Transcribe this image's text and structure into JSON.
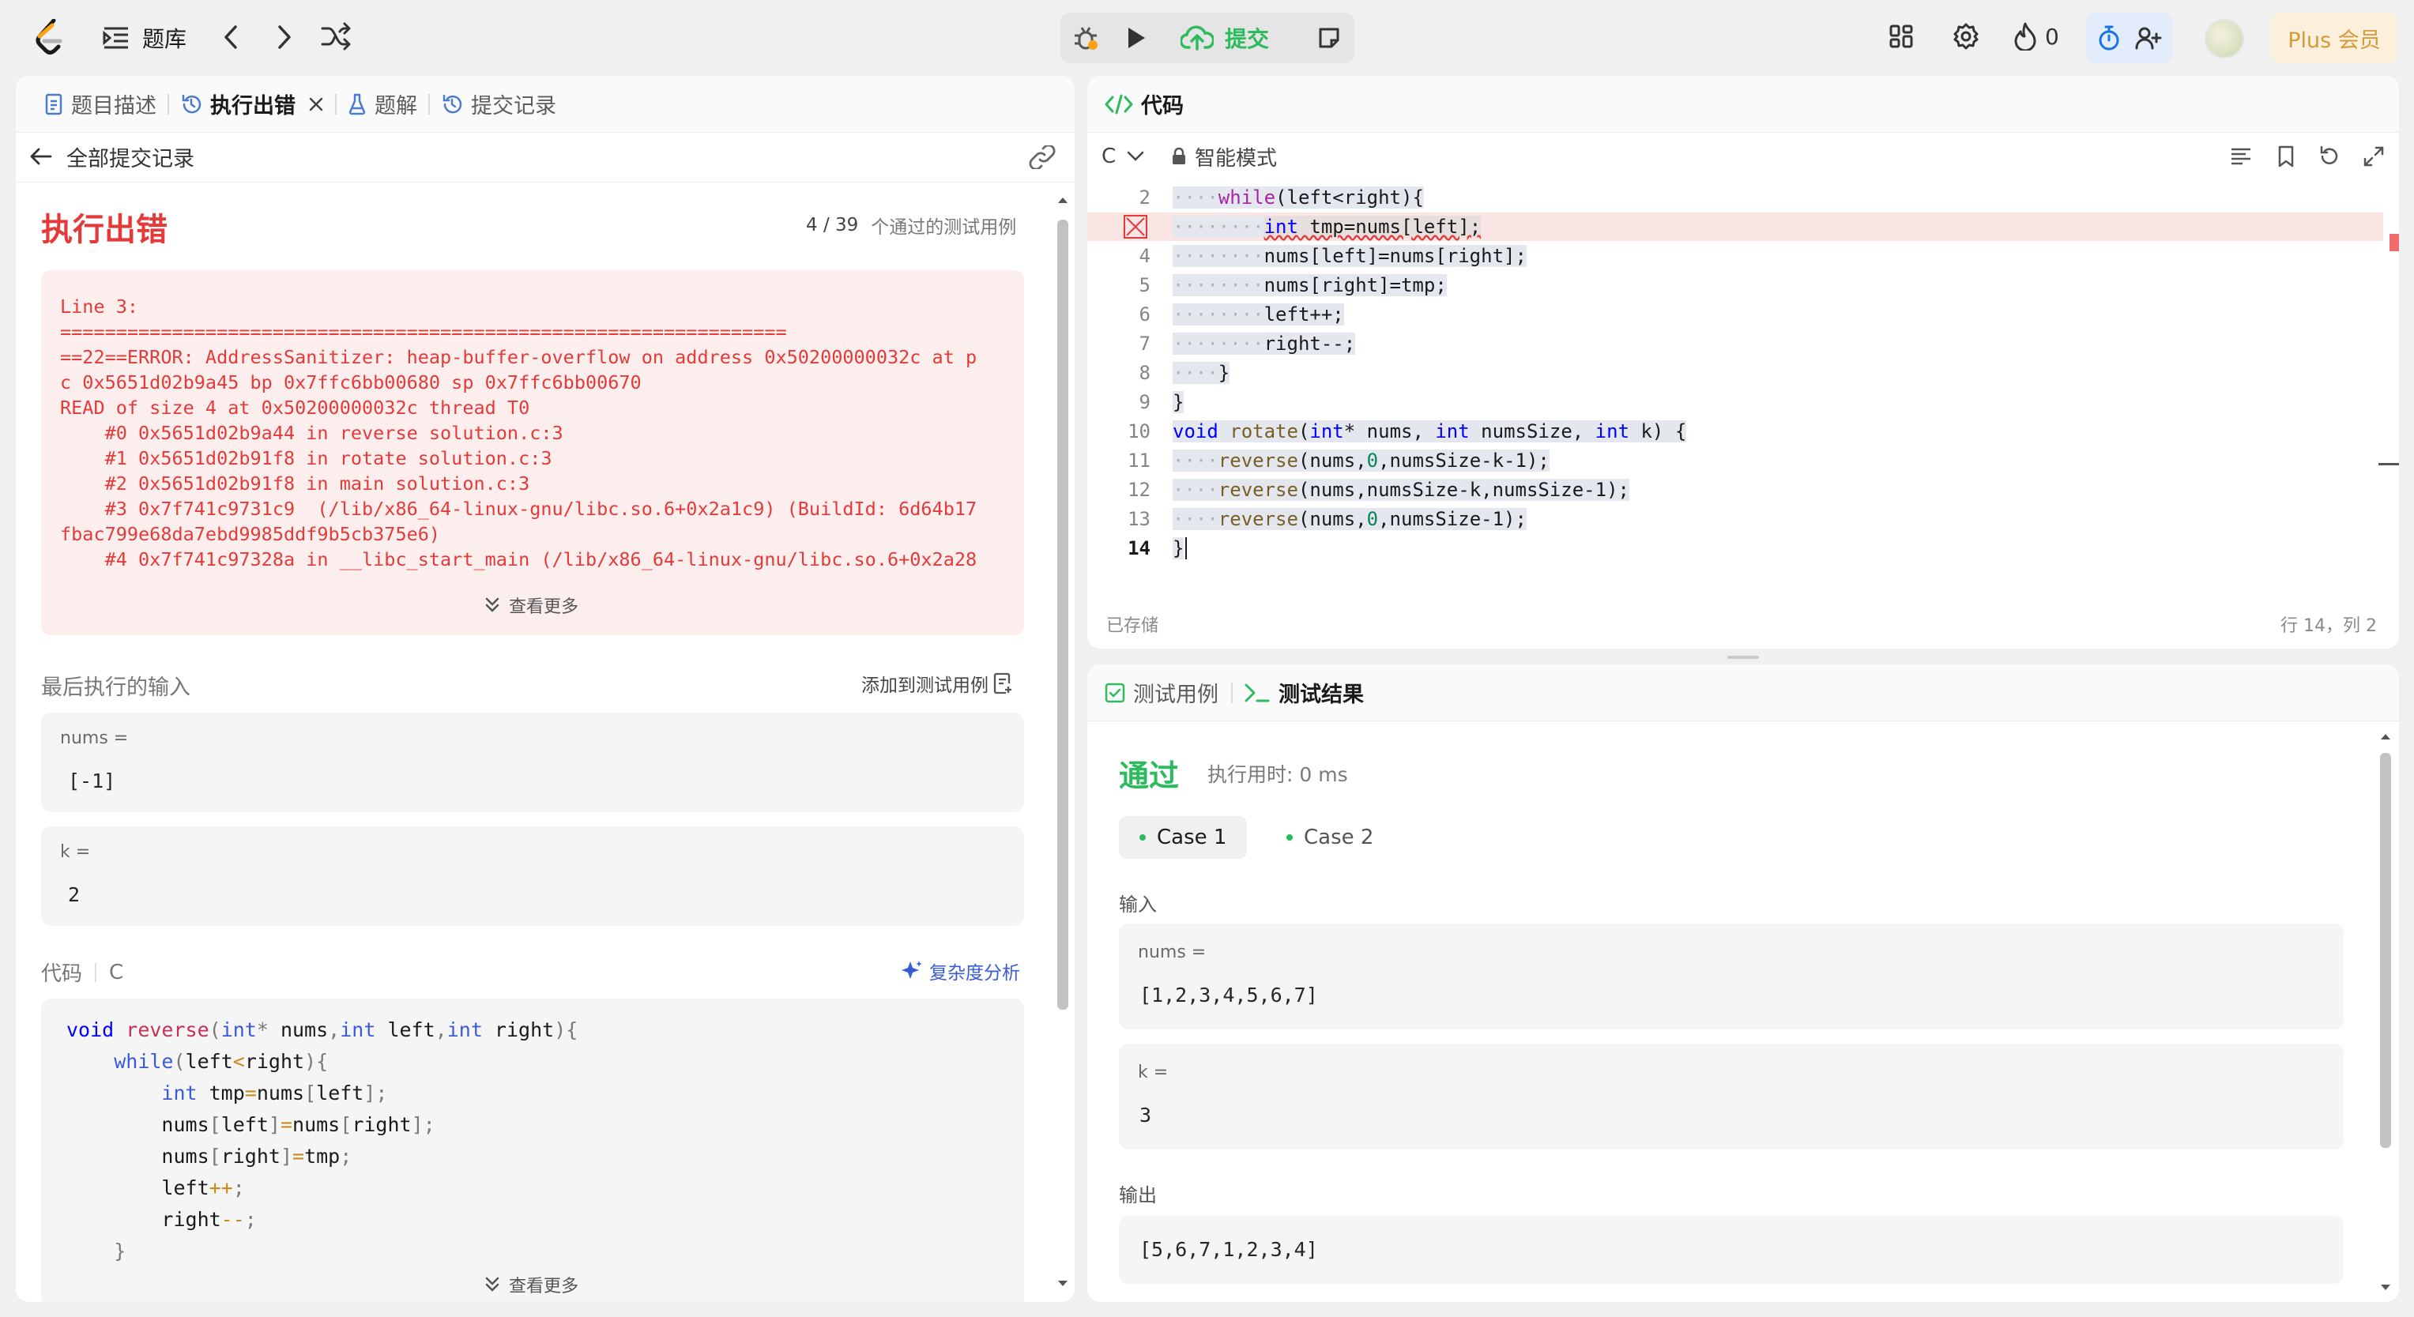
{
  "topbar": {
    "problem_bank": "题库",
    "submit_label": "提交",
    "streak_count": "0",
    "plus_label": "Plus 会员",
    "colors": {
      "submit_green": "#2cbb5d",
      "plus_gold": "#d49a3a",
      "timer_blue": "#1a73e8"
    }
  },
  "left": {
    "tabs": [
      {
        "label": "题目描述",
        "icon": "document-icon"
      },
      {
        "label": "执行出错",
        "icon": "history-icon"
      },
      {
        "label": "题解",
        "icon": "flask-icon"
      },
      {
        "label": "提交记录",
        "icon": "history-icon"
      }
    ],
    "back_label": "全部提交记录",
    "status_title": "执行出错",
    "passed_count": "4 / 39",
    "passed_label": "个通过的测试用例",
    "error_lines": [
      "Line 3:",
      "=================================================================",
      "==22==ERROR: AddressSanitizer: heap-buffer-overflow on address 0x50200000032c at p",
      "c 0x5651d02b9a45 bp 0x7ffc6bb00680 sp 0x7ffc6bb00670",
      "READ of size 4 at 0x50200000032c thread T0",
      "    #0 0x5651d02b9a44 in reverse solution.c:3",
      "    #1 0x5651d02b91f8 in rotate solution.c:3",
      "    #2 0x5651d02b91f8 in main solution.c:3",
      "    #3 0x7f741c9731c9  (/lib/x86_64-linux-gnu/libc.so.6+0x2a1c9) (BuildId: 6d64b17",
      "fbac799e68da7ebd9985ddf9b5cb375e6)",
      "    #4 0x7f741c97328a in __libc_start_main (/lib/x86_64-linux-gnu/libc.so.6+0x2a28"
    ],
    "see_more": "查看更多",
    "last_input_label": "最后执行的输入",
    "add_testcase_label": "添加到测试用例",
    "inputs": [
      {
        "name": "nums =",
        "value": "[-1]"
      },
      {
        "name": "k =",
        "value": "2"
      }
    ],
    "code_label": "代码",
    "code_lang": "C",
    "complexity_label": "复杂度分析",
    "code_lines": [
      [
        [
          "fn-decl",
          "void "
        ],
        [
          "fn",
          "reverse"
        ],
        [
          "p",
          "("
        ],
        [
          "kw",
          "int"
        ],
        [
          "p",
          "* "
        ],
        [
          "id",
          "nums"
        ],
        [
          "p",
          ","
        ],
        [
          "kw",
          "int"
        ],
        [
          "id",
          " left"
        ],
        [
          "p",
          ","
        ],
        [
          "kw",
          "int"
        ],
        [
          "id",
          " right"
        ],
        [
          "p",
          "){"
        ]
      ],
      [
        [
          "id",
          "    "
        ],
        [
          "kw",
          "while"
        ],
        [
          "p",
          "("
        ],
        [
          "id",
          "left"
        ],
        [
          "op",
          "<"
        ],
        [
          "id",
          "right"
        ],
        [
          "p",
          "){"
        ]
      ],
      [
        [
          "id",
          "        "
        ],
        [
          "kw",
          "int"
        ],
        [
          "id",
          " tmp"
        ],
        [
          "op",
          "="
        ],
        [
          "id",
          "nums"
        ],
        [
          "p",
          "["
        ],
        [
          "id",
          "left"
        ],
        [
          "p",
          "];"
        ]
      ],
      [
        [
          "id",
          "        nums"
        ],
        [
          "p",
          "["
        ],
        [
          "id",
          "left"
        ],
        [
          "p",
          "]"
        ],
        [
          "op",
          "="
        ],
        [
          "id",
          "nums"
        ],
        [
          "p",
          "["
        ],
        [
          "id",
          "right"
        ],
        [
          "p",
          "];"
        ]
      ],
      [
        [
          "id",
          "        nums"
        ],
        [
          "p",
          "["
        ],
        [
          "id",
          "right"
        ],
        [
          "p",
          "]"
        ],
        [
          "op",
          "="
        ],
        [
          "id",
          "tmp"
        ],
        [
          "p",
          ";"
        ]
      ],
      [
        [
          "id",
          "        left"
        ],
        [
          "op",
          "++"
        ],
        [
          "p",
          ";"
        ]
      ],
      [
        [
          "id",
          "        right"
        ],
        [
          "op",
          "--"
        ],
        [
          "p",
          ";"
        ]
      ],
      [
        [
          "p",
          "    }"
        ]
      ]
    ]
  },
  "editor": {
    "title": "代码",
    "lang": "C",
    "mode": "智能模式",
    "saved_label": "已存储",
    "cursor_pos": "行 14，列 2",
    "lines": [
      {
        "n": "2",
        "ws": "····",
        "code": [
          [
            "kw2",
            "while"
          ],
          [
            "p",
            "(left<right){"
          ]
        ]
      },
      {
        "n": "",
        "ws": "········",
        "code": [
          [
            "kw",
            "int"
          ],
          [
            "p",
            " tmp=nums[left];"
          ]
        ],
        "error": true
      },
      {
        "n": "4",
        "ws": "········",
        "code": [
          [
            "p",
            "nums[left]=nums[right];"
          ]
        ]
      },
      {
        "n": "5",
        "ws": "········",
        "code": [
          [
            "p",
            "nums[right]=tmp;"
          ]
        ]
      },
      {
        "n": "6",
        "ws": "········",
        "code": [
          [
            "p",
            "left++;"
          ]
        ]
      },
      {
        "n": "7",
        "ws": "········",
        "code": [
          [
            "p",
            "right--;"
          ]
        ]
      },
      {
        "n": "8",
        "ws": "····",
        "code": [
          [
            "p",
            "}"
          ]
        ]
      },
      {
        "n": "9",
        "ws": "",
        "code": [
          [
            "p",
            "}"
          ]
        ]
      },
      {
        "n": "10",
        "ws": "",
        "code": [
          [
            "kw",
            "void"
          ],
          [
            "p",
            " "
          ],
          [
            "fn",
            "rotate"
          ],
          [
            "p",
            "("
          ],
          [
            "kw",
            "int"
          ],
          [
            "p",
            "* nums, "
          ],
          [
            "kw",
            "int"
          ],
          [
            "p",
            " numsSize, "
          ],
          [
            "kw",
            "int"
          ],
          [
            "p",
            " k) {"
          ]
        ]
      },
      {
        "n": "11",
        "ws": "····",
        "code": [
          [
            "fn",
            "reverse"
          ],
          [
            "p",
            "(nums,"
          ],
          [
            "num",
            "0"
          ],
          [
            "p",
            ",numsSize-k-1);"
          ]
        ]
      },
      {
        "n": "12",
        "ws": "····",
        "code": [
          [
            "fn",
            "reverse"
          ],
          [
            "p",
            "(nums,numsSize-k,numsSize-1);"
          ]
        ]
      },
      {
        "n": "13",
        "ws": "····",
        "code": [
          [
            "fn",
            "reverse"
          ],
          [
            "p",
            "(nums,"
          ],
          [
            "num",
            "0"
          ],
          [
            "p",
            ",numsSize-1);"
          ]
        ]
      },
      {
        "n": "14",
        "ws": "",
        "code": [
          [
            "p",
            "}"
          ]
        ],
        "current": true
      }
    ]
  },
  "tests": {
    "tab_cases": "测试用例",
    "tab_result": "测试结果",
    "status": "通过",
    "runtime": "执行用时: 0 ms",
    "cases": [
      "Case 1",
      "Case 2"
    ],
    "input_label": "输入",
    "inputs": [
      {
        "name": "nums =",
        "value": "[1,2,3,4,5,6,7]"
      },
      {
        "name": "k =",
        "value": "3"
      }
    ],
    "output_label": "输出",
    "output_value": "[5,6,7,1,2,3,4]"
  }
}
